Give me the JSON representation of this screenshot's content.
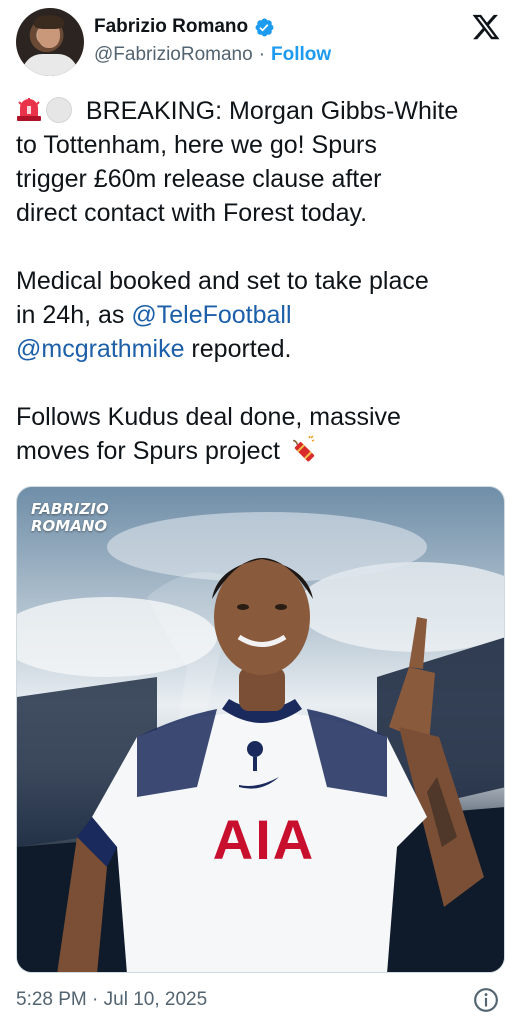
{
  "author": {
    "name": "Fabrizio Romano",
    "handle": "@FabrizioRomano",
    "separator": "·",
    "follow_label": "Follow",
    "verified_color": "#1d9bf0"
  },
  "tweet": {
    "line1_prefix": "BREAKING: Morgan Gibbs-White",
    "line1_rest": "to Tottenham, here we go! Spurs\ntrigger £60m release clause after\ndirect contact with Forest today.",
    "para2_start": "Medical booked and set to take place\nin 24h, as ",
    "mention1": "@TeleFootball",
    "mention2": "@mcgrathmike",
    "para2_end": " reported.",
    "para3": "Follows Kudus deal done, massive\nmoves for Spurs project ",
    "emojis": [
      "rotating-light-icon",
      "white-circle-icon",
      "firecracker-icon"
    ]
  },
  "media": {
    "watermark_line1": "FABRIZIO",
    "watermark_line2": "ROMANO",
    "shirt_sponsor": "AIA",
    "accent_red": "#c8102e",
    "kit_navy": "#1a2a5c"
  },
  "footer": {
    "timestamp": "5:28 PM · Jul 10, 2025",
    "info_icon": "info-icon"
  },
  "platform_icon": "x-logo-icon"
}
